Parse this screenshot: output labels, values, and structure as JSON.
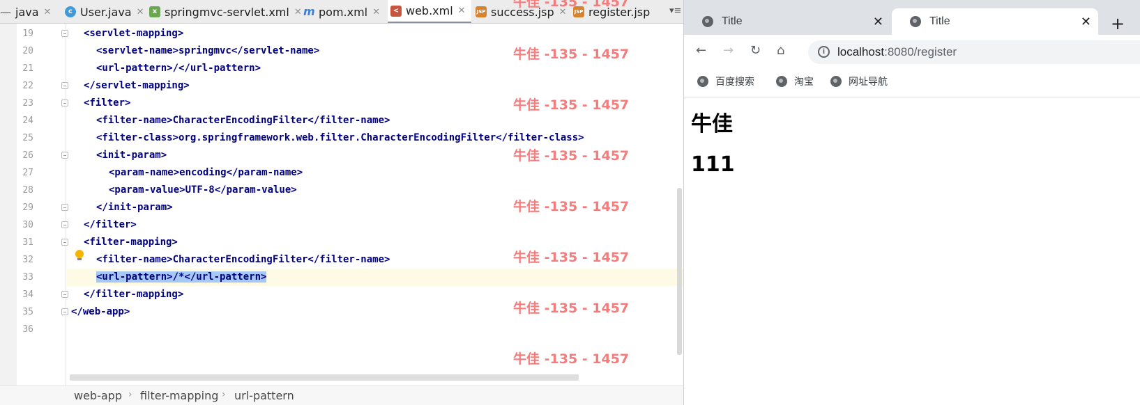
{
  "ide": {
    "tabs": [
      {
        "label": "java",
        "icon": "java-file-icon"
      },
      {
        "label": "User.java",
        "icon": "class-icon"
      },
      {
        "label": "springmvc-servlet.xml",
        "icon": "spring-xml-icon"
      },
      {
        "label": "pom.xml",
        "icon": "maven-icon"
      },
      {
        "label": "web.xml",
        "icon": "xml-icon",
        "active": true
      },
      {
        "label": "success.jsp",
        "icon": "jsp-icon"
      },
      {
        "label": "register.jsp",
        "icon": "jsp-icon"
      }
    ],
    "code_lines": [
      {
        "num": "19",
        "text": "<servlet-mapping>"
      },
      {
        "num": "20",
        "text": "<servlet-name>springmvc</servlet-name>"
      },
      {
        "num": "21",
        "text": "<url-pattern>/</url-pattern>"
      },
      {
        "num": "22",
        "text": "</servlet-mapping>"
      },
      {
        "num": "23",
        "text": "<filter>"
      },
      {
        "num": "24",
        "text": "<filter-name>CharacterEncodingFilter</filter-name>"
      },
      {
        "num": "25",
        "text": "<filter-class>org.springframework.web.filter.CharacterEncodingFilter</filter-class>"
      },
      {
        "num": "26",
        "text": "<init-param>"
      },
      {
        "num": "27",
        "text": "<param-name>encoding</param-name>"
      },
      {
        "num": "28",
        "text": "<param-value>UTF-8</param-value>"
      },
      {
        "num": "29",
        "text": "</init-param>"
      },
      {
        "num": "30",
        "text": "</filter>"
      },
      {
        "num": "31",
        "text": "<filter-mapping>"
      },
      {
        "num": "32",
        "text": "<filter-name>CharacterEncodingFilter</filter-name>"
      },
      {
        "num": "33",
        "text": "<url-pattern>/*</url-pattern>",
        "current": true
      },
      {
        "num": "34",
        "text": "</filter-mapping>"
      },
      {
        "num": "35",
        "text": "</web-app>"
      },
      {
        "num": "36",
        "text": ""
      }
    ],
    "watermark": "牛佳 -135 - 1457",
    "breadcrumb": [
      "web-app",
      "filter-mapping",
      "url-pattern"
    ]
  },
  "browser": {
    "tabs": [
      {
        "title": "Title",
        "active": false
      },
      {
        "title": "Title",
        "active": true
      }
    ],
    "url_host": "localhost",
    "url_rest": ":8080/register",
    "bookmarks": [
      "百度搜索",
      "淘宝",
      "网址导航"
    ],
    "page": {
      "heading1": "牛佳",
      "heading2": "111"
    }
  },
  "colors": {
    "tag": "#000080",
    "watermark": "#f47c7c",
    "selection": "#a5c8f4",
    "current_line": "#fdfbe6"
  }
}
